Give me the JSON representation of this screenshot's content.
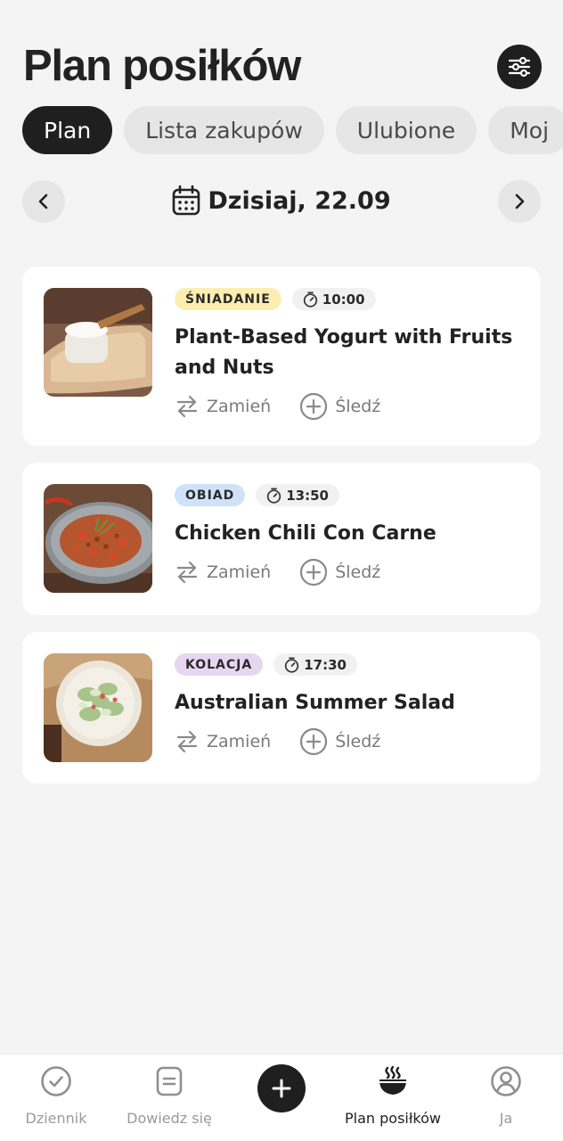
{
  "header": {
    "title": "Plan posiłków",
    "filter_icon": "sliders-icon"
  },
  "tabs": [
    {
      "label": "Plan",
      "active": true
    },
    {
      "label": "Lista zakupów",
      "active": false
    },
    {
      "label": "Ulubione",
      "active": false
    },
    {
      "label": "Moj",
      "active": false
    }
  ],
  "date_nav": {
    "date_label": "Dzisiaj, 22.09",
    "prev_icon": "chevron-left-icon",
    "next_icon": "chevron-right-icon",
    "calendar_icon": "calendar-icon"
  },
  "meals": [
    {
      "tag": "ŚNIADANIE",
      "tag_color": "#fbeeb0",
      "time": "10:00",
      "title": "Plant-Based Yogurt with Fruits and Nuts",
      "swap_label": "Zamień",
      "track_label": "Śledź"
    },
    {
      "tag": "OBIAD",
      "tag_color": "#cfe3f8",
      "time": "13:50",
      "title": "Chicken Chili Con Carne",
      "swap_label": "Zamień",
      "track_label": "Śledź"
    },
    {
      "tag": "KOLACJA",
      "tag_color": "#e7d6ef",
      "time": "17:30",
      "title": "Australian Summer Salad",
      "swap_label": "Zamień",
      "track_label": "Śledź"
    }
  ],
  "bottom_nav": {
    "items": [
      {
        "label": "Dziennik",
        "icon": "check-circle-icon",
        "active": false
      },
      {
        "label": "Dowiedz się",
        "icon": "document-icon",
        "active": false
      },
      {
        "label": "Plan posiłków",
        "icon": "bowl-icon",
        "active": true
      },
      {
        "label": "Ja",
        "icon": "user-circle-icon",
        "active": false
      }
    ],
    "add_icon": "plus-icon"
  }
}
